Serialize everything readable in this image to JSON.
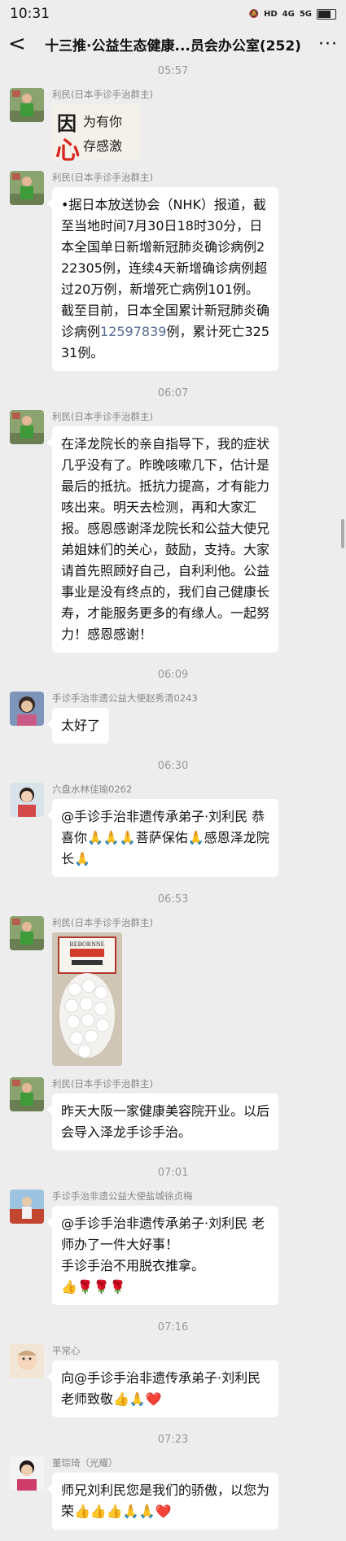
{
  "status": {
    "time": "10:31",
    "network1": "HD",
    "network2": "4G",
    "network3": "5G"
  },
  "header": {
    "back_label": "<",
    "title": "十三推·公益生态健康...员会办公室(252)",
    "more_label": "···"
  },
  "messages": [
    {
      "time": "05:57"
    },
    {
      "sender": "利民(日本手诊手治群主)",
      "sticker": {
        "line1": "因",
        "line2": "心",
        "line3": "为有你",
        "line4": "存感激"
      }
    },
    {
      "sender": "利民(日本手诊手治群主)",
      "text_a": "•据日本放送协会（NHK）报道，截至当地时间7月30日18时30分，日本全国单日新增新冠肺炎确诊病例222305例，连续4天新增确诊病例超过20万例，新增死亡病例101例。截至目前，日本全国累计新冠肺炎确诊病例",
      "link": "12597839",
      "text_b": "例，累计死亡32531例。"
    },
    {
      "time": "06:07"
    },
    {
      "sender": "利民(日本手诊手治群主)",
      "text": "在泽龙院长的亲自指导下，我的症状几乎没有了。昨晚咳嗽几下，估计是最后的抵抗。抵抗力提高，才有能力咳出来。明天去检测，再和大家汇报。感恩感谢泽龙院长和公益大使兄弟姐妹们的关心，鼓励，支持。大家请首先照顾好自己，自利利他。公益事业是没有终点的，我们自己健康长寿，才能服务更多的有缘人。一起努力！感恩感谢！"
    },
    {
      "time": "06:09"
    },
    {
      "sender": "手诊手治非遗公益大使赵秀清0243",
      "text": "太好了"
    },
    {
      "time": "06:30"
    },
    {
      "sender": "六盘水林佳瑜0262",
      "text": "@手诊手治非遗传承弟子·刘利民 恭喜你🙏🙏🙏菩萨保佑🙏感恩泽龙院长🙏"
    },
    {
      "time": "06:53"
    },
    {
      "sender": "利民(日本手诊手治群主)",
      "photo": {
        "banner": "REBORNNE"
      }
    },
    {
      "sender": "利民(日本手诊手治群主)",
      "text": "昨天大阪一家健康美容院开业。以后会导入泽龙手诊手治。"
    },
    {
      "time": "07:01"
    },
    {
      "sender": "手诊手治非遗公益大使盐城徐贞梅",
      "text": "@手诊手治非遗传承弟子·刘利民 老师办了一件大好事！\n手诊手治不用脱衣推拿。\n👍🌹🌹🌹"
    },
    {
      "time": "07:16"
    },
    {
      "sender": "平常心",
      "text": "向@手诊手治非遗传承弟子·刘利民老师致敬👍🙏❤️"
    },
    {
      "time": "07:23"
    },
    {
      "sender": "董琮琦（光耀）",
      "text": "师兄刘利民您是我们的骄傲，以您为荣👍👍👍🙏🙏❤️"
    }
  ]
}
